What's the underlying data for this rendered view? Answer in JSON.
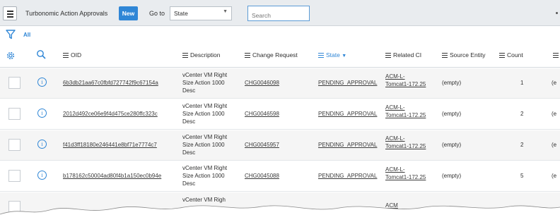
{
  "header": {
    "menu_icon": "hamburger-icon",
    "title": "Turbonomic Action Approvals",
    "new_label": "New",
    "goto_label": "Go to",
    "select_value": "State",
    "search_placeholder": "Search"
  },
  "filter": {
    "icon": "funnel-icon",
    "label": "All"
  },
  "columns": [
    {
      "label": "OID"
    },
    {
      "label": "Description"
    },
    {
      "label": "Change Request"
    },
    {
      "label": "State",
      "sort": "▼"
    },
    {
      "label": "Related CI"
    },
    {
      "label": "Source Entity"
    },
    {
      "label": "Count"
    }
  ],
  "rows": [
    {
      "oid": "6b3db21aa67c0fbfd727742f9c67154a",
      "desc": "vCenter VM Right Size Action 1000 Desc",
      "change": "CHG0046098",
      "state": "PENDING_APPROVAL",
      "ci": "ACM-L-Tomcat1-172.25",
      "source": "(empty)",
      "count": "1",
      "trunc": "(e"
    },
    {
      "oid": "2012d492ce06e9f4d475ce280ffc323c",
      "desc": "vCenter VM Right Size Action 1000 Desc",
      "change": "CHG0046598",
      "state": "PENDING_APPROVAL",
      "ci": "ACM-L-Tomcat1-172.25",
      "source": "(empty)",
      "count": "2",
      "trunc": "(e"
    },
    {
      "oid": "f41d3ff18180e246441e8bf71e7774c7",
      "desc": "vCenter VM Right Size Action 1000 Desc",
      "change": "CHG0045957",
      "state": "PENDING_APPROVAL",
      "ci": "ACM-L-Tomcat1-172.25",
      "source": "(empty)",
      "count": "2",
      "trunc": "(e"
    },
    {
      "oid": "b178162c50004ad80f4b1a150ec0b94e",
      "desc": "vCenter VM Right Size Action 1000 Desc",
      "change": "CHG0045088",
      "state": "PENDING_APPROVAL",
      "ci": "ACM-L-Tomcat1-172.25",
      "source": "(empty)",
      "count": "5",
      "trunc": "(e"
    }
  ],
  "partial_row": {
    "desc": "vCenter VM Righ",
    "ci": "ACM"
  },
  "colors": {
    "accent": "#2f86d6",
    "header_bg": "#e9ecef"
  }
}
